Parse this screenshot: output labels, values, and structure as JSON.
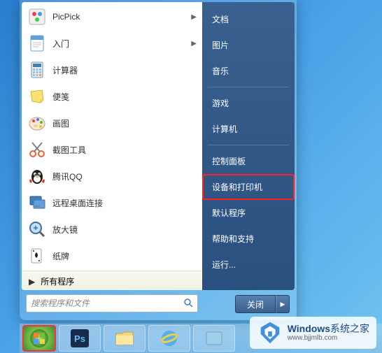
{
  "programs": [
    {
      "label": "PicPick",
      "icon": "picpick",
      "submenu": true
    },
    {
      "label": "入门",
      "icon": "intro",
      "submenu": true
    },
    {
      "label": "计算器",
      "icon": "calculator",
      "submenu": false
    },
    {
      "label": "便笺",
      "icon": "sticky",
      "submenu": false
    },
    {
      "label": "画图",
      "icon": "paint",
      "submenu": false
    },
    {
      "label": "截图工具",
      "icon": "snip",
      "submenu": false
    },
    {
      "label": "腾讯QQ",
      "icon": "qq",
      "submenu": false
    },
    {
      "label": "远程桌面连接",
      "icon": "rdp",
      "submenu": false
    },
    {
      "label": "放大镜",
      "icon": "magnifier",
      "submenu": false
    },
    {
      "label": "纸牌",
      "icon": "solitaire",
      "submenu": false
    }
  ],
  "all_programs_label": "所有程序",
  "search_placeholder": "搜索程序和文件",
  "right_items_top": [
    {
      "label": "文档"
    },
    {
      "label": "图片"
    },
    {
      "label": "音乐"
    },
    {
      "label": "游戏"
    },
    {
      "label": "计算机"
    }
  ],
  "right_items_mid": [
    {
      "label": "控制面板"
    },
    {
      "label": "设备和打印机",
      "highlighted": true
    },
    {
      "label": "默认程序"
    },
    {
      "label": "帮助和支持"
    },
    {
      "label": "运行..."
    }
  ],
  "shutdown_label": "关闭",
  "watermark": {
    "title_prefix": "Windows",
    "title_suffix": "系统之家",
    "url": "www.bjjmlb.com"
  }
}
